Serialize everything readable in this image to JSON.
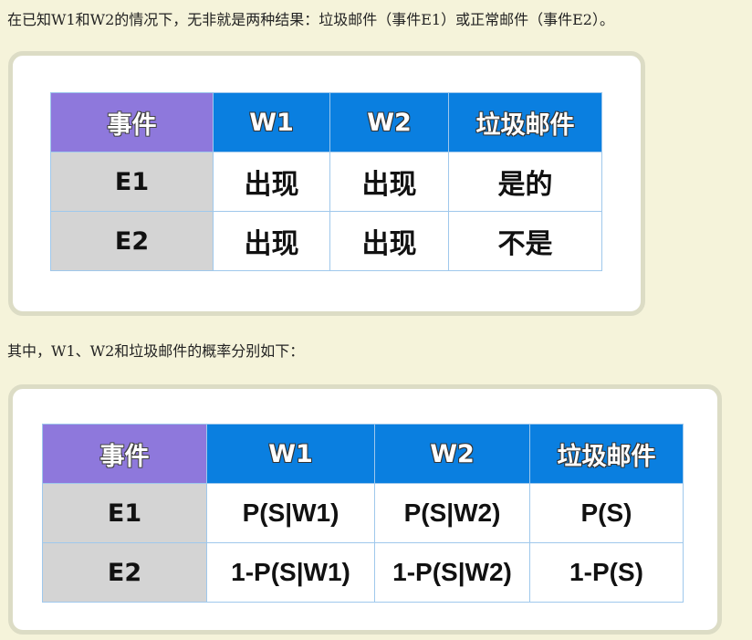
{
  "intro_text": "在已知W1和W2的情况下，无非就是两种结果：垃圾邮件（事件E1）或正常邮件（事件E2）。",
  "table1": {
    "headers": [
      "事件",
      "W1",
      "W2",
      "垃圾邮件"
    ],
    "rows": [
      {
        "label": "E1",
        "cells": [
          "出现",
          "出现",
          "是的"
        ]
      },
      {
        "label": "E2",
        "cells": [
          "出现",
          "出现",
          "不是"
        ]
      }
    ]
  },
  "middle_text": "其中，W1、W2和垃圾邮件的概率分别如下：",
  "table2": {
    "headers": [
      "事件",
      "W1",
      "W2",
      "垃圾邮件"
    ],
    "rows": [
      {
        "label": "E1",
        "cells": [
          "P(S|W1)",
          "P(S|W2)",
          "P(S)"
        ]
      },
      {
        "label": "E2",
        "cells": [
          "1-P(S|W1)",
          "1-P(S|W2)",
          "1-P(S)"
        ]
      }
    ]
  },
  "colors": {
    "background": "#f5f3da",
    "header_purple": "#8e78dc",
    "header_blue": "#0a7fe0",
    "row_label_gray": "#d4d4d4"
  }
}
